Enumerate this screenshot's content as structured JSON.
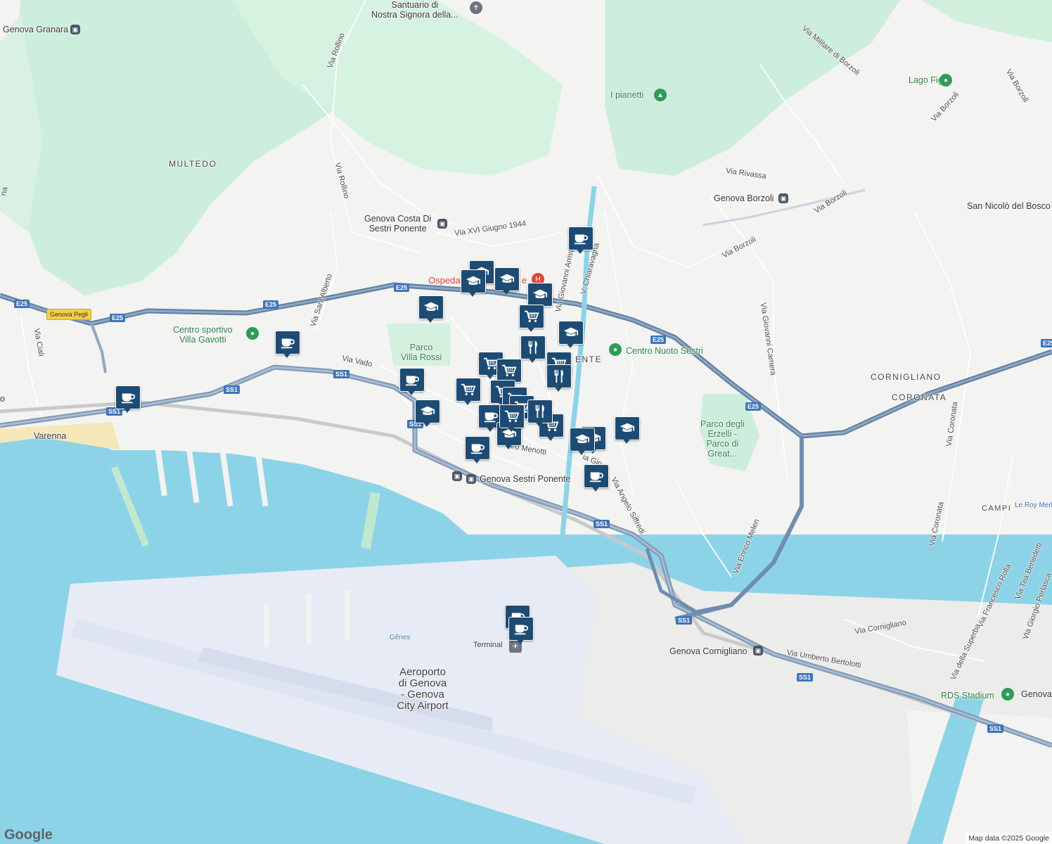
{
  "map": {
    "provider_logo": "Google",
    "attribution": "Map data ©2025 Google",
    "colors": {
      "water": "#8cd3e8",
      "land": "#f3f3f1",
      "green": "#cfeedd",
      "major_road": "#7f97b4",
      "marker": "#1e4b73",
      "airport": "#e7ebf5"
    }
  },
  "labels": {
    "multedo": "MULTEDO",
    "cornigliano": "CORNIGLIANO",
    "coronata": "CORONATA",
    "campi": "CAMPI",
    "ponente_fragment": "ENTE",
    "santuario": "Santuario di\nNostra Signora della...",
    "genova_granara": "Genova Granara",
    "via_rollino_1": "Via Rollino",
    "via_rollino_2": "Via Rollino",
    "via_militare": "Via Militare di Borzoli",
    "lago_figoi": "Lago Figoi",
    "via_borzoli_1": "Via Borzoli",
    "via_borzoli_2": "Via Borzoli",
    "via_borzoli_3": "Via Borzoli",
    "via_borzoli_4": "Via Borzoli",
    "i_pianetti": "I pianetti",
    "via_rivassa": "Via Rivassa",
    "genova_borzoli": "Genova Borzoli",
    "san_nicolo": "San Nicolò del Bosco",
    "genova_costa": "Genova Costa Di\nSestri Ponente",
    "via_xvi_giugno": "Via XVI Giugno 1944",
    "ospedale": "Ospeda",
    "ospedale_tail": "e",
    "via_giovanni_arrivabene": "Via Giovanni Arrivabe",
    "v_chiaravagna": "V. Chiaravagna",
    "via_sant_alberto": "Via Sant'Alberto",
    "genova_pegli": "Genova Pegli",
    "via_ciali": "Via Ciali",
    "centro_sportivo": "Centro sportivo\nVilla Gavotti",
    "parco_villa_rossi": "Parco\nVilla Rossi",
    "via_vado": "Via Vado",
    "centro_nuoto": "Centro Nuoto Sestri",
    "via_giovanni_camera": "Via Giovanni Camera",
    "parco_erzelli": "Parco degli\nErzelli -\nParco di\nGreat...",
    "via_coronata_1": "Via Coronata",
    "via_coronata_2": "Via Coronata",
    "le_roy_merlin": "Le Roy Merl",
    "varenna": "Varenna",
    "menotti": "iro Menotti",
    "via_gio": "ia Gio",
    "genova_sestri_ponente": "Genova Sestri Ponente",
    "via_angelo_siffredi": "Via Angelo Siffredi",
    "via_enrico_melen": "Via Enrico Melen",
    "via_francesco_rolla": "Via Francesco Rolla",
    "via_tea_benedetti": "Via Tea Benedetti",
    "via_giorgio_perlasca": "Via Giorgio Perlasca",
    "via_della_superba": "Via della Superba",
    "via_cornigliano": "Via Cornigliano",
    "genova_cornigliano": "Genova Cornigliano",
    "via_umberto_bertolotti": "Via Umberto Bertolotti",
    "rds_stadium": "RDS Stadium",
    "genova_fragment": "Genova",
    "genes": "Gênes",
    "terminal": "Terminal",
    "airport": "Aeroporto\ndi Genova\n- Genova\nCity Airport",
    "o_fragment": "o",
    "na_fragment": "na"
  },
  "road_shields": {
    "e25_a": "E25",
    "e25_b": "E25",
    "e25_c": "E25",
    "e25_d": "E25",
    "e25_e": "E25",
    "e25_f": "E25",
    "e25_g": "E25",
    "ss1_a": "SS1",
    "ss1_b": "SS1",
    "ss1_c": "SS1",
    "ss1_d": "SS1",
    "ss1_e": "SS1",
    "ss1_f": "SS1",
    "ss1_g": "SS1",
    "ss1_h": "SS1"
  },
  "markers": [
    {
      "icon": "education"
    },
    {
      "icon": "education"
    },
    {
      "icon": "education"
    },
    {
      "icon": "education"
    },
    {
      "icon": "cafe"
    },
    {
      "icon": "grocery"
    },
    {
      "icon": "education"
    },
    {
      "icon": "restaurant"
    },
    {
      "icon": "grocery"
    },
    {
      "icon": "cafe"
    },
    {
      "icon": "cafe"
    },
    {
      "icon": "grocery"
    },
    {
      "icon": "cafe"
    },
    {
      "icon": "grocery"
    },
    {
      "icon": "grocery"
    },
    {
      "icon": "restaurant"
    },
    {
      "icon": "grocery"
    },
    {
      "icon": "grocery"
    },
    {
      "icon": "grocery"
    },
    {
      "icon": "education"
    },
    {
      "icon": "cafe"
    },
    {
      "icon": "education"
    },
    {
      "icon": "grocery"
    },
    {
      "icon": "restaurant"
    },
    {
      "icon": "grocery"
    },
    {
      "icon": "education"
    },
    {
      "icon": "education"
    },
    {
      "icon": "education"
    },
    {
      "icon": "cafe"
    },
    {
      "icon": "cafe"
    },
    {
      "icon": "cafe"
    },
    {
      "icon": "cafe"
    },
    {
      "icon": "education"
    }
  ]
}
